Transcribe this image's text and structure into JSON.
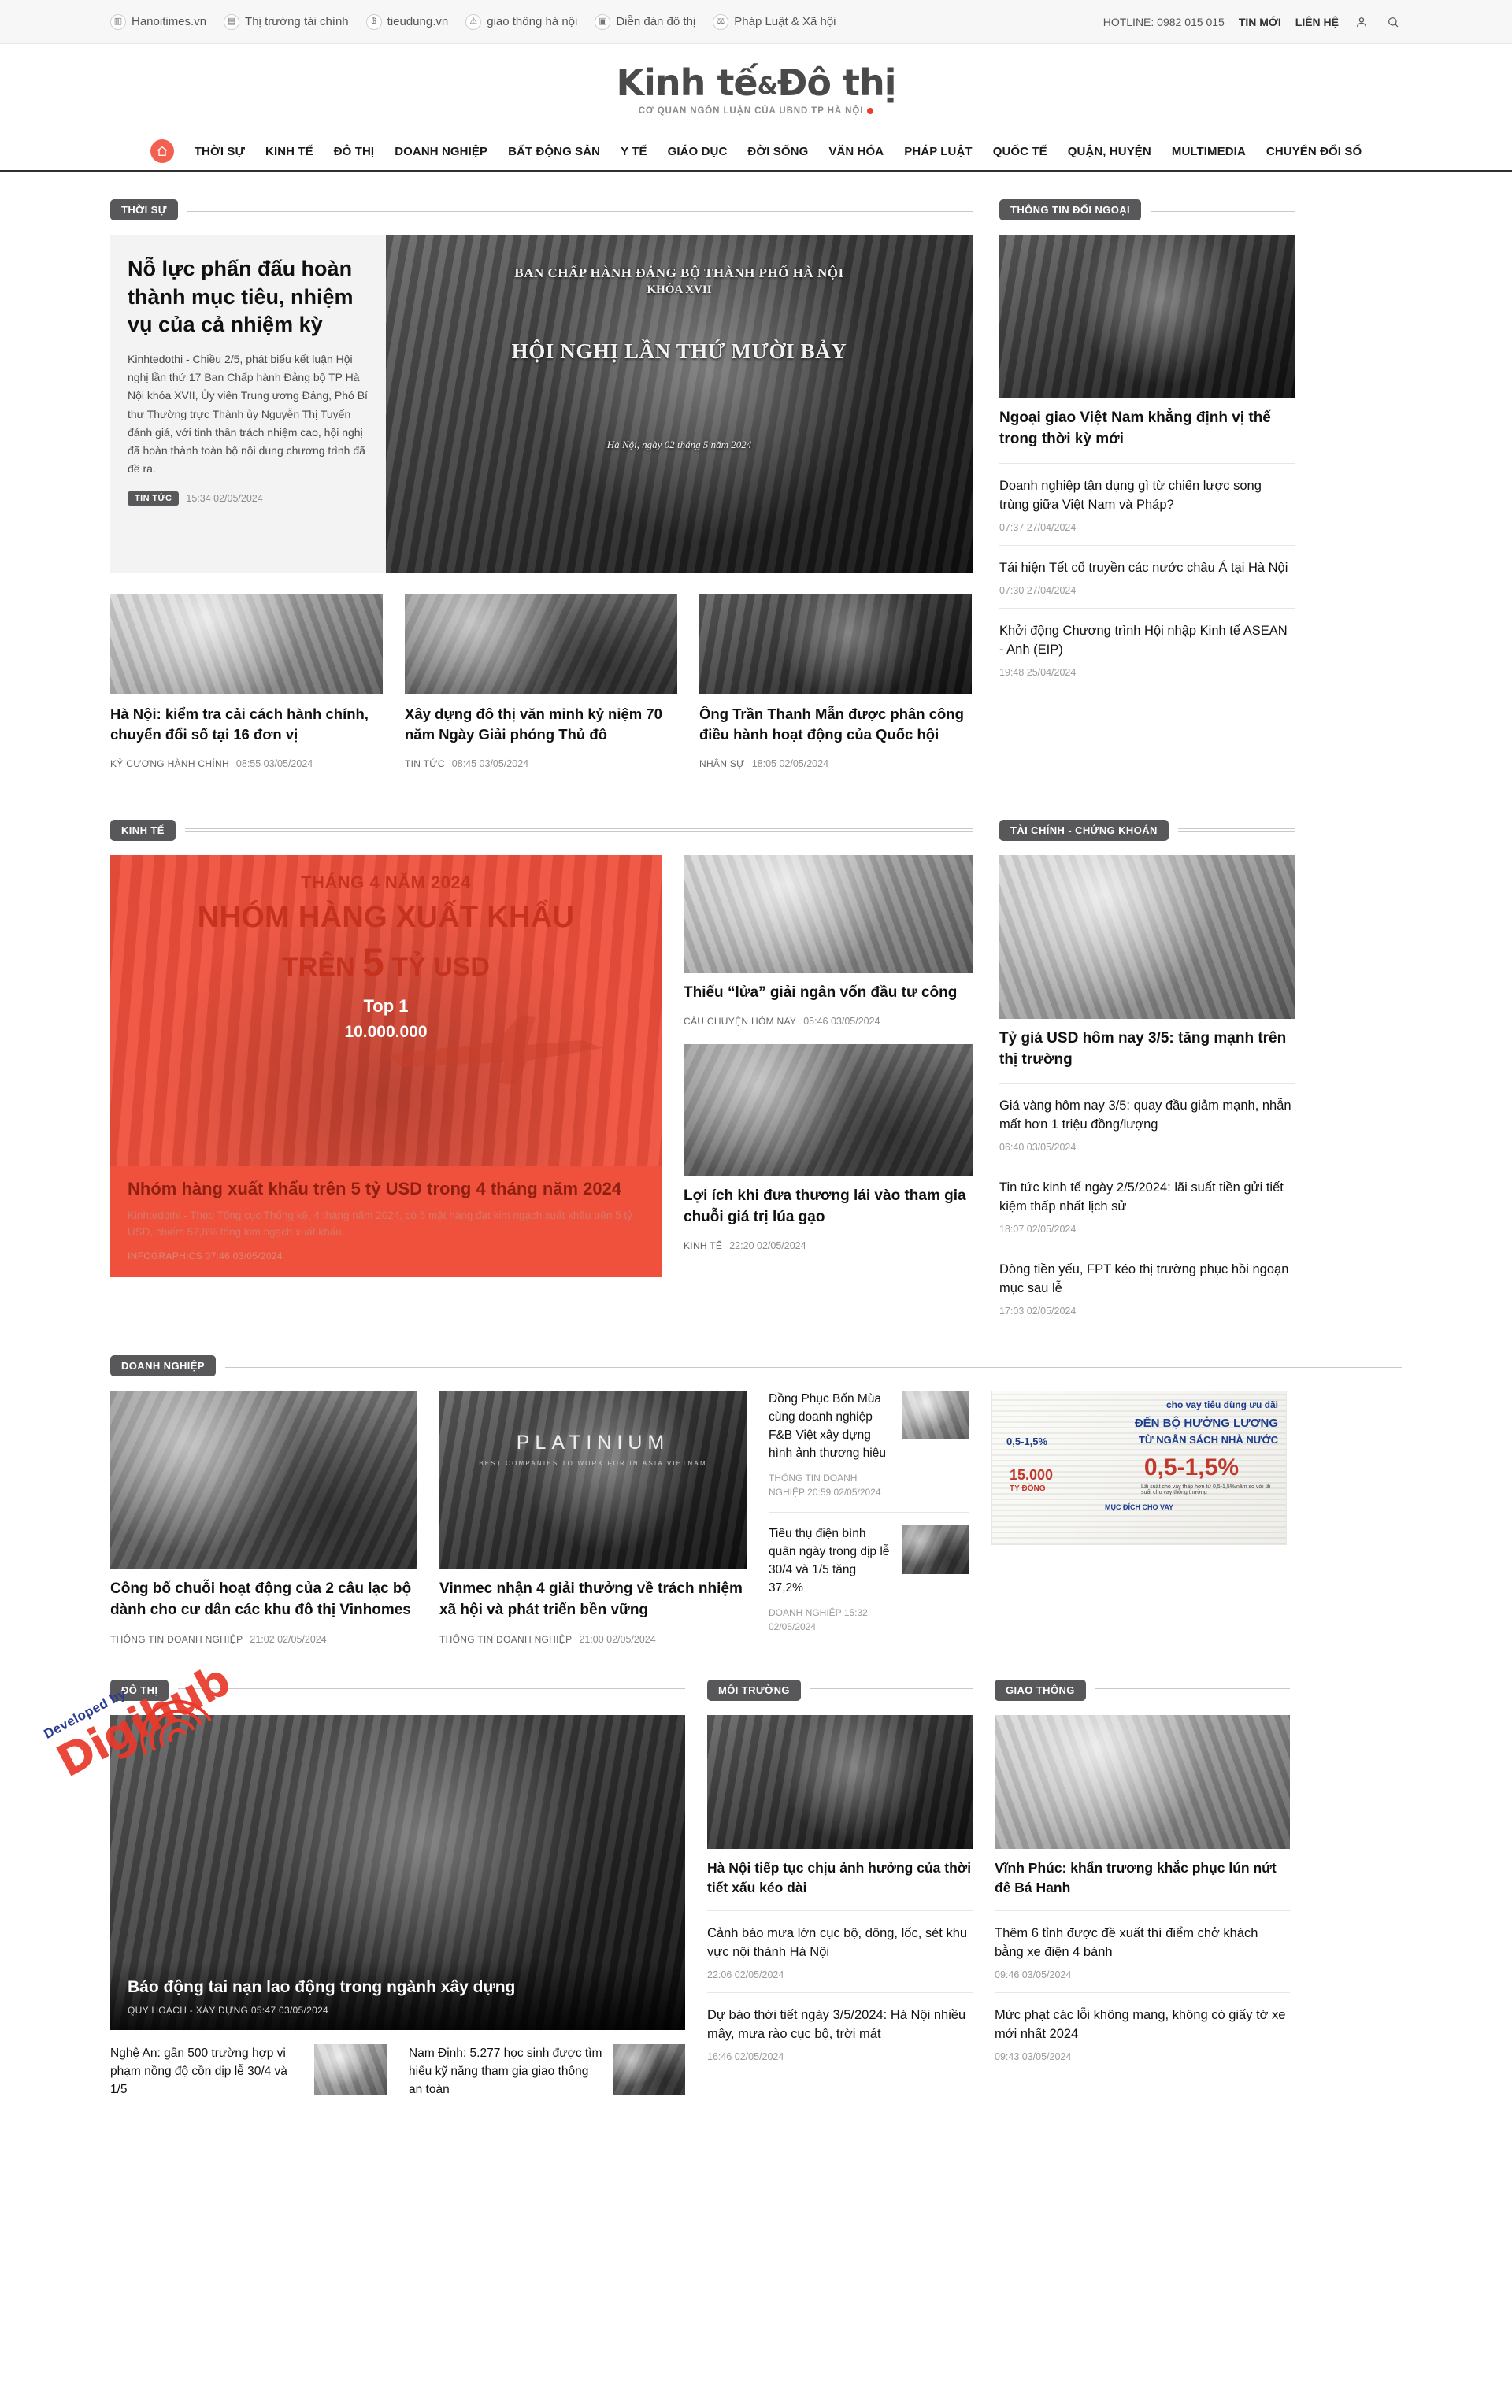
{
  "topbar": {
    "links": [
      {
        "label": "Hanoitimes.vn",
        "icon": "building-icon"
      },
      {
        "label": "Thị trường tài chính",
        "icon": "chart-icon"
      },
      {
        "label": "tieudung.vn",
        "icon": "dollar-icon"
      },
      {
        "label": "giao thông hà nội",
        "icon": "warning-icon"
      },
      {
        "label": "Diễn đàn đô thị",
        "icon": "bus-icon"
      },
      {
        "label": "Pháp Luật & Xã hội",
        "icon": "scales-icon"
      }
    ],
    "hotline": "HOTLINE: 0982 015 015",
    "tin_moi": "TIN MỚI",
    "lien_he": "LIÊN HỆ",
    "account_icon": "user-icon",
    "search_icon": "search-icon"
  },
  "masthead": {
    "logo_a": "Kinh tế",
    "logo_amp": "&",
    "logo_b": "Đô thị",
    "tagline": "CƠ QUAN NGÔN LUẬN CỦA UBND TP HÀ NỘI"
  },
  "nav": {
    "home_icon": "home-icon",
    "items": [
      "THỜI SỰ",
      "KINH TẾ",
      "ĐÔ THỊ",
      "DOANH NGHIỆP",
      "BẤT ĐỘNG SẢN",
      "Y TẾ",
      "GIÁO DỤC",
      "ĐỜI SỐNG",
      "VĂN HÓA",
      "PHÁP LUẬT",
      "QUỐC TẾ",
      "QUẬN, HUYỆN",
      "MULTIMEDIA",
      "CHUYỂN ĐỔI SỐ"
    ]
  },
  "thoi_su": {
    "section": "THỜI SỰ",
    "hero": {
      "title": "Nỗ lực phấn đấu hoàn thành mục tiêu, nhiệm vụ của cả nhiệm kỳ",
      "summary": "Kinhtedothi - Chiều 2/5, phát biểu kết luận Hội nghị lần thứ 17 Ban Chấp hành Đảng bộ TP Hà Nội khóa XVII, Ủy viên Trung ương Đảng, Phó Bí thư Thường trực Thành ủy Nguyễn Thị Tuyến đánh giá, với tinh thần trách nhiệm cao, hội nghị đã hoàn thành toàn bộ nội dung chương trình đã đề ra.",
      "chip": "TIN TỨC",
      "time": "15:34 02/05/2024",
      "slide_l1": "BAN CHẤP HÀNH ĐẢNG BỘ THÀNH PHỐ HÀ NỘI",
      "slide_l2": "KHÓA XVII",
      "slide_l3": "HỘI NGHỊ LẦN THỨ MƯỜI BẢY",
      "slide_l4": "Hà Nội, ngày 02 tháng 5 năm 2024"
    },
    "cards": [
      {
        "title": "Hà Nội: kiểm tra cải cách hành chính, chuyển đổi số tại 16 đơn vị",
        "cat": "KỶ CƯƠNG HÀNH CHÍNH",
        "time": "08:55 03/05/2024"
      },
      {
        "title": "Xây dựng đô thị văn minh kỷ niệm 70 năm Ngày Giải phóng Thủ đô",
        "cat": "TIN TỨC",
        "time": "08:45 03/05/2024"
      },
      {
        "title": "Ông Trần Thanh Mẫn được phân công điều hành hoạt động của Quốc hội",
        "cat": "NHÂN SỰ",
        "time": "18:05 02/05/2024"
      }
    ]
  },
  "doi_ngoai": {
    "section": "THÔNG TIN ĐỐI NGOẠI",
    "lead": {
      "title": "Ngoại giao Việt Nam khẳng định vị thế trong thời kỳ mới"
    },
    "items": [
      {
        "title": "Doanh nghiệp tận dụng gì từ chiến lược song trùng giữa Việt Nam và Pháp?",
        "time": "07:37 27/04/2024"
      },
      {
        "title": "Tái hiện Tết cổ truyền các nước châu Á tại Hà Nội",
        "time": "07:30 27/04/2024"
      },
      {
        "title": "Khởi động Chương trình Hội nhập Kinh tế ASEAN - Anh (EIP)",
        "time": "19:48 25/04/2024"
      }
    ]
  },
  "kinh_te": {
    "section": "KINH TẾ",
    "infographic": {
      "line1": "THÁNG 4 NĂM 2024",
      "line2": "NHÓM HÀNG XUẤT KHẨU",
      "line3_a": "TRÊN",
      "line3_b": "5",
      "line3_c": "TỶ USD",
      "top_label": "Top 1",
      "top_value": "10.000.000",
      "caption_title": "Nhóm hàng xuất khẩu trên 5 tỷ USD trong 4 tháng năm 2024",
      "caption_summary": "Kinhtedothi - Theo Tổng cục Thống kê, 4 tháng năm 2024, có 5 mặt hàng đạt kim ngạch xuất khẩu trên 5 tỷ USD, chiếm 57,8% tổng kim ngạch xuất khẩu.",
      "caption_cat": "INFOGRAPHICS",
      "caption_time": "07:46 03/05/2024"
    },
    "mid": [
      {
        "title": "Thiếu “lửa” giải ngân vốn đầu tư công",
        "cat": "CÂU CHUYỆN HÔM NAY",
        "time": "05:46 03/05/2024"
      },
      {
        "title": "Lợi ích khi đưa thương lái vào tham gia chuỗi giá trị lúa gạo",
        "cat": "KINH TẾ",
        "time": "22:20 02/05/2024"
      }
    ]
  },
  "tai_chinh": {
    "section": "TÀI CHÍNH - CHỨNG KHOÁN",
    "lead": {
      "title": "Tỷ giá USD hôm nay 3/5: tăng mạnh trên thị trường"
    },
    "items": [
      {
        "title": "Giá vàng hôm nay 3/5: quay đầu giảm mạnh, nhẫn mất hơn 1 triệu đồng/lượng",
        "time": "06:40 03/05/2024"
      },
      {
        "title": "Tin tức kinh tế ngày 2/5/2024: lãi suất tiền gửi tiết kiệm thấp nhất lịch sử",
        "time": "18:07 02/05/2024"
      },
      {
        "title": "Dòng tiền yếu, FPT kéo thị trường phục hồi ngoạn mục sau lễ",
        "time": "17:03 02/05/2024"
      }
    ]
  },
  "doanh_nghiep": {
    "section": "DOANH NGHIỆP",
    "a": {
      "title": "Công bố chuỗi hoạt động của 2 câu lạc bộ dành cho cư dân các khu đô thị Vinhomes",
      "cat": "THÔNG TIN DOANH NGHIỆP",
      "time": "21:02 02/05/2024"
    },
    "b": {
      "title": "Vinmec nhận 4 giải thưởng về trách nhiệm xã hội và phát triển bền vững",
      "cat": "THÔNG TIN DOANH NGHIỆP",
      "time": "21:00 02/05/2024",
      "badge": "PLATINIUM",
      "badge_sub": "BEST COMPANIES TO WORK FOR IN ASIA VIETNAM"
    },
    "list": [
      {
        "title": "Đồng Phục Bốn Mùa cùng doanh nghiệp F&B Việt xây dựng hình ảnh thương hiệu",
        "cat": "THÔNG TIN DOANH NGHIỆP",
        "time": "20:59 02/05/2024"
      },
      {
        "title": "Tiêu thụ điện bình quân ngày trong dịp lễ 30/4 và 1/5 tăng 37,2%",
        "cat": "DOANH NGHIỆP",
        "time": "15:32 02/05/2024"
      }
    ],
    "ad": {
      "headline": "cho vay tiêu dùng ưu đãi",
      "line2": "ĐẾN BỘ HƯỞNG LƯƠNG",
      "line3": "TỪ NGÂN SÁCH NHÀ NƯỚC",
      "rate_small": "0,5-1,5%",
      "rate_big": "0,5-1,5",
      "rate_unit": "%",
      "amount": "15.000",
      "amount_unit": "TỶ ĐỒNG",
      "note": "Lãi suất cho vay thấp hơn từ 0,5-1,5%/năm so với lãi suất cho vay thông thường",
      "purpose_label": "MỤC ĐÍCH CHO VAY"
    }
  },
  "do_thi": {
    "section": "ĐÔ THỊ",
    "hero": {
      "title": "Báo động tai nạn lao động trong ngành xây dựng",
      "cat": "QUY HOẠCH - XÂY DỰNG",
      "time": "05:47 03/05/2024"
    },
    "subs": [
      {
        "title": "Nghệ An: gần 500 trường hợp vi phạm nồng độ cồn dịp lễ 30/4 và 1/5"
      },
      {
        "title": "Nam Định: 5.277 học sinh được tìm hiểu kỹ năng tham gia giao thông an toàn"
      }
    ]
  },
  "moi_truong": {
    "section": "MÔI TRƯỜNG",
    "lead": {
      "title": "Hà Nội tiếp tục chịu ảnh hưởng của thời tiết xấu kéo dài"
    },
    "items": [
      {
        "title": "Cảnh báo mưa lớn cục bộ, dông, lốc, sét khu vực nội thành Hà Nội",
        "time": "22:06 02/05/2024"
      },
      {
        "title": "Dự báo thời tiết ngày 3/5/2024: Hà Nội nhiều mây, mưa rào cục bộ, trời mát",
        "time": "16:46 02/05/2024"
      }
    ]
  },
  "giao_thong": {
    "section": "GIAO THÔNG",
    "lead": {
      "title": "Vĩnh Phúc: khẩn trương khắc phục lún nứt đê Bá Hanh"
    },
    "items": [
      {
        "title": "Thêm 6 tỉnh được đề xuất thí điểm chở khách bằng xe điện 4 bánh",
        "time": "09:46 03/05/2024"
      },
      {
        "title": "Mức phạt các lỗi không mang, không có giấy tờ xe mới nhất 2024",
        "time": "09:43 03/05/2024"
      }
    ]
  },
  "watermark": {
    "text": "Digihub",
    "sub": "Developed by"
  },
  "colors": {
    "accent_red": "#f0513c",
    "chip_gray": "#58585a",
    "home_icon": "#f4604f"
  }
}
